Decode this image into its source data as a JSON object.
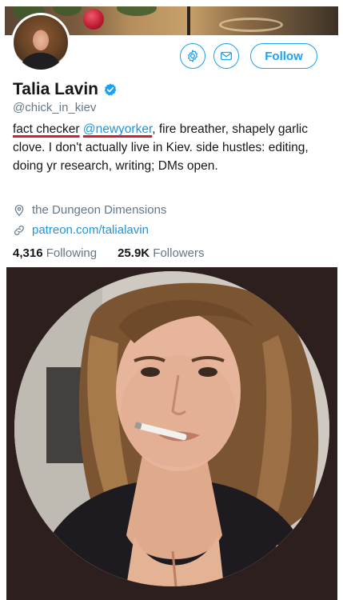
{
  "profile": {
    "display_name": "Talia Lavin",
    "handle": "@chick_in_kiev",
    "bio": {
      "underlined_text": "fact checker",
      "mention": "@newyorker",
      "rest": ", fire breather, shapely garlic clove. I don't actually live in Kiev. side hustles: editing, doing yr research, writing; DMs open."
    },
    "location": "the Dungeon Dimensions",
    "link": "patreon.com/talialavin",
    "following_count": "4,316",
    "following_label": "Following",
    "followers_count": "25.9K",
    "followers_label": "Followers"
  },
  "actions": {
    "settings_icon": "gear-icon",
    "message_icon": "envelope-icon",
    "follow_label": "Follow"
  },
  "colors": {
    "accent": "#1da1f2",
    "link": "#1b95e0",
    "secondary_text": "#657786",
    "underline_marker": "#d02030"
  }
}
